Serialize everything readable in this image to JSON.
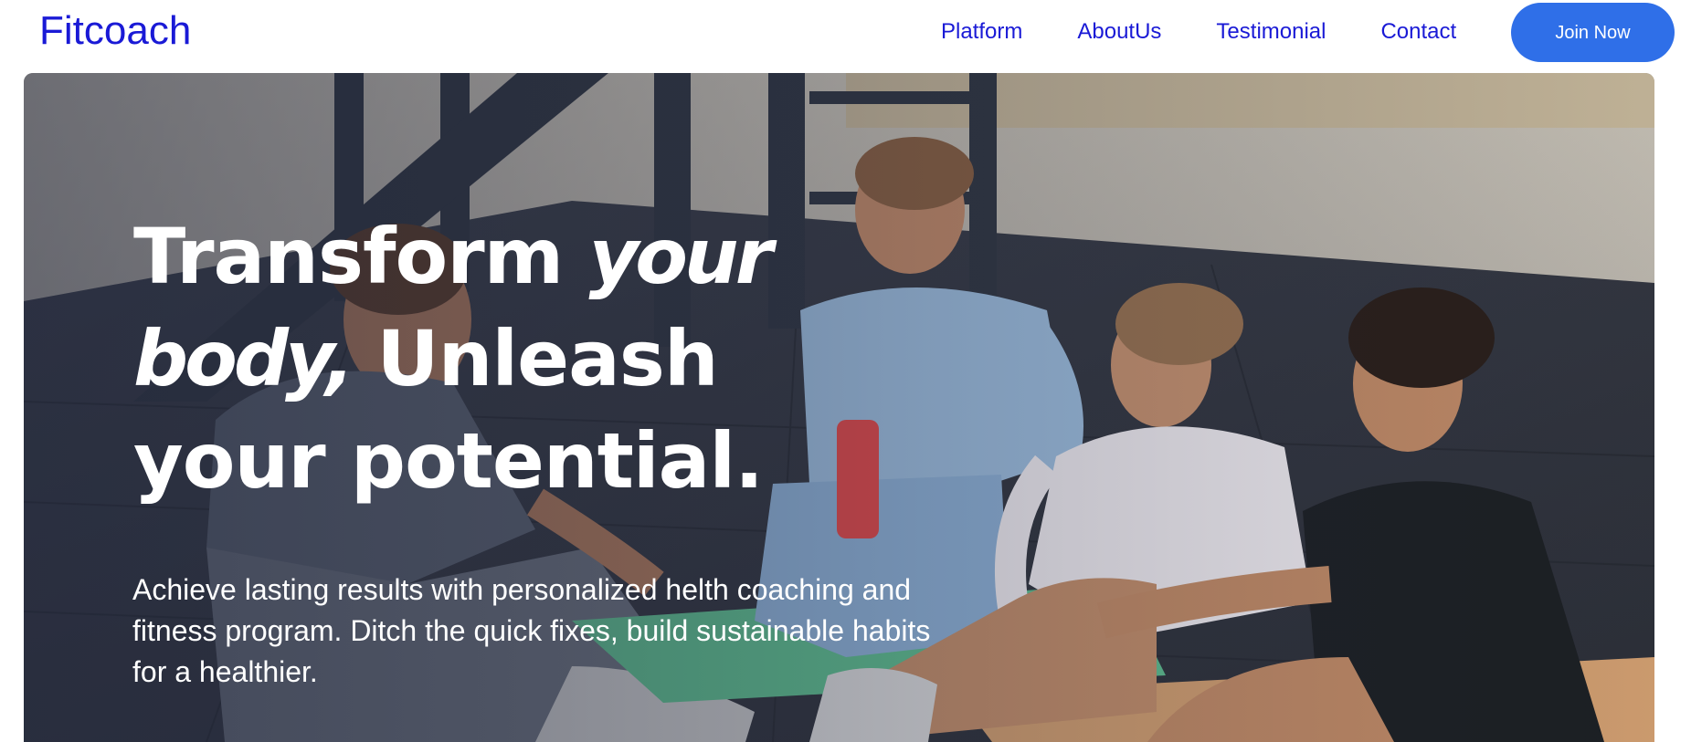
{
  "brand": {
    "name": "Fitcoach",
    "color": "#1a1ad6"
  },
  "nav": {
    "links": [
      "Platform",
      "AboutUs",
      "Testimonial",
      "Contact"
    ],
    "cta_label": "Join Now",
    "cta_color": "#2f6fe8"
  },
  "hero": {
    "headline": {
      "part1": "Transform ",
      "part2_emphasis": "your body,",
      "part3": " Unleash your potential."
    },
    "subtext": "Achieve lasting results with personalized helth coaching and fitness program. Ditch the quick fixes, build sustainable habits for a healthier.",
    "image_description_icon": "group-workout-photo-icon"
  }
}
